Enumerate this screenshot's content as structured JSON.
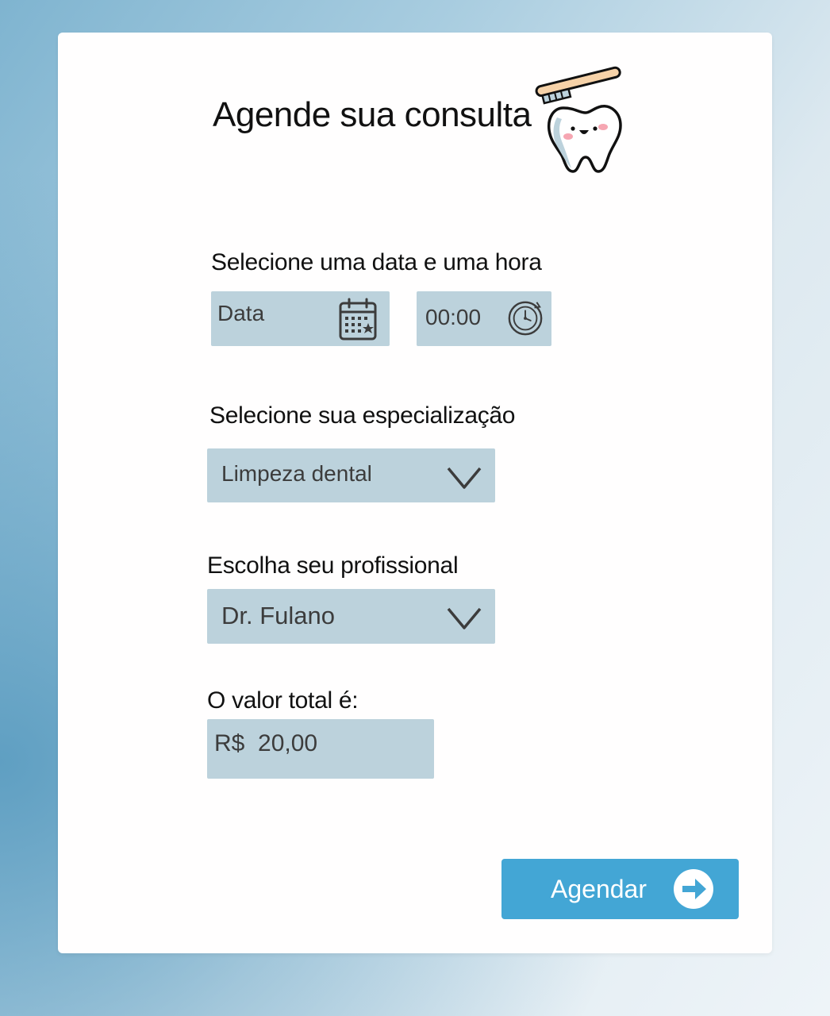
{
  "header": {
    "title": "Agende sua consulta",
    "illustration_icon": "tooth-with-toothbrush-icon"
  },
  "datetime": {
    "label": "Selecione uma data e uma hora",
    "date_placeholder": "Data",
    "date_icon": "calendar-icon",
    "time_value": "00:00",
    "time_icon": "clock-icon"
  },
  "specialization": {
    "label": "Selecione sua especialização",
    "selected": "Limpeza dental",
    "icon": "chevron-down-icon"
  },
  "professional": {
    "label": "Escolha seu profissional",
    "selected": "Dr. Fulano",
    "icon": "chevron-down-icon"
  },
  "total": {
    "label": "O valor total é:",
    "value": "R$  20,00"
  },
  "submit": {
    "label": "Agendar",
    "icon": "arrow-right-circle-icon"
  },
  "colors": {
    "field_bg": "#bcd2dc",
    "button_bg": "#43a6d5",
    "card_bg": "#fffefe"
  }
}
